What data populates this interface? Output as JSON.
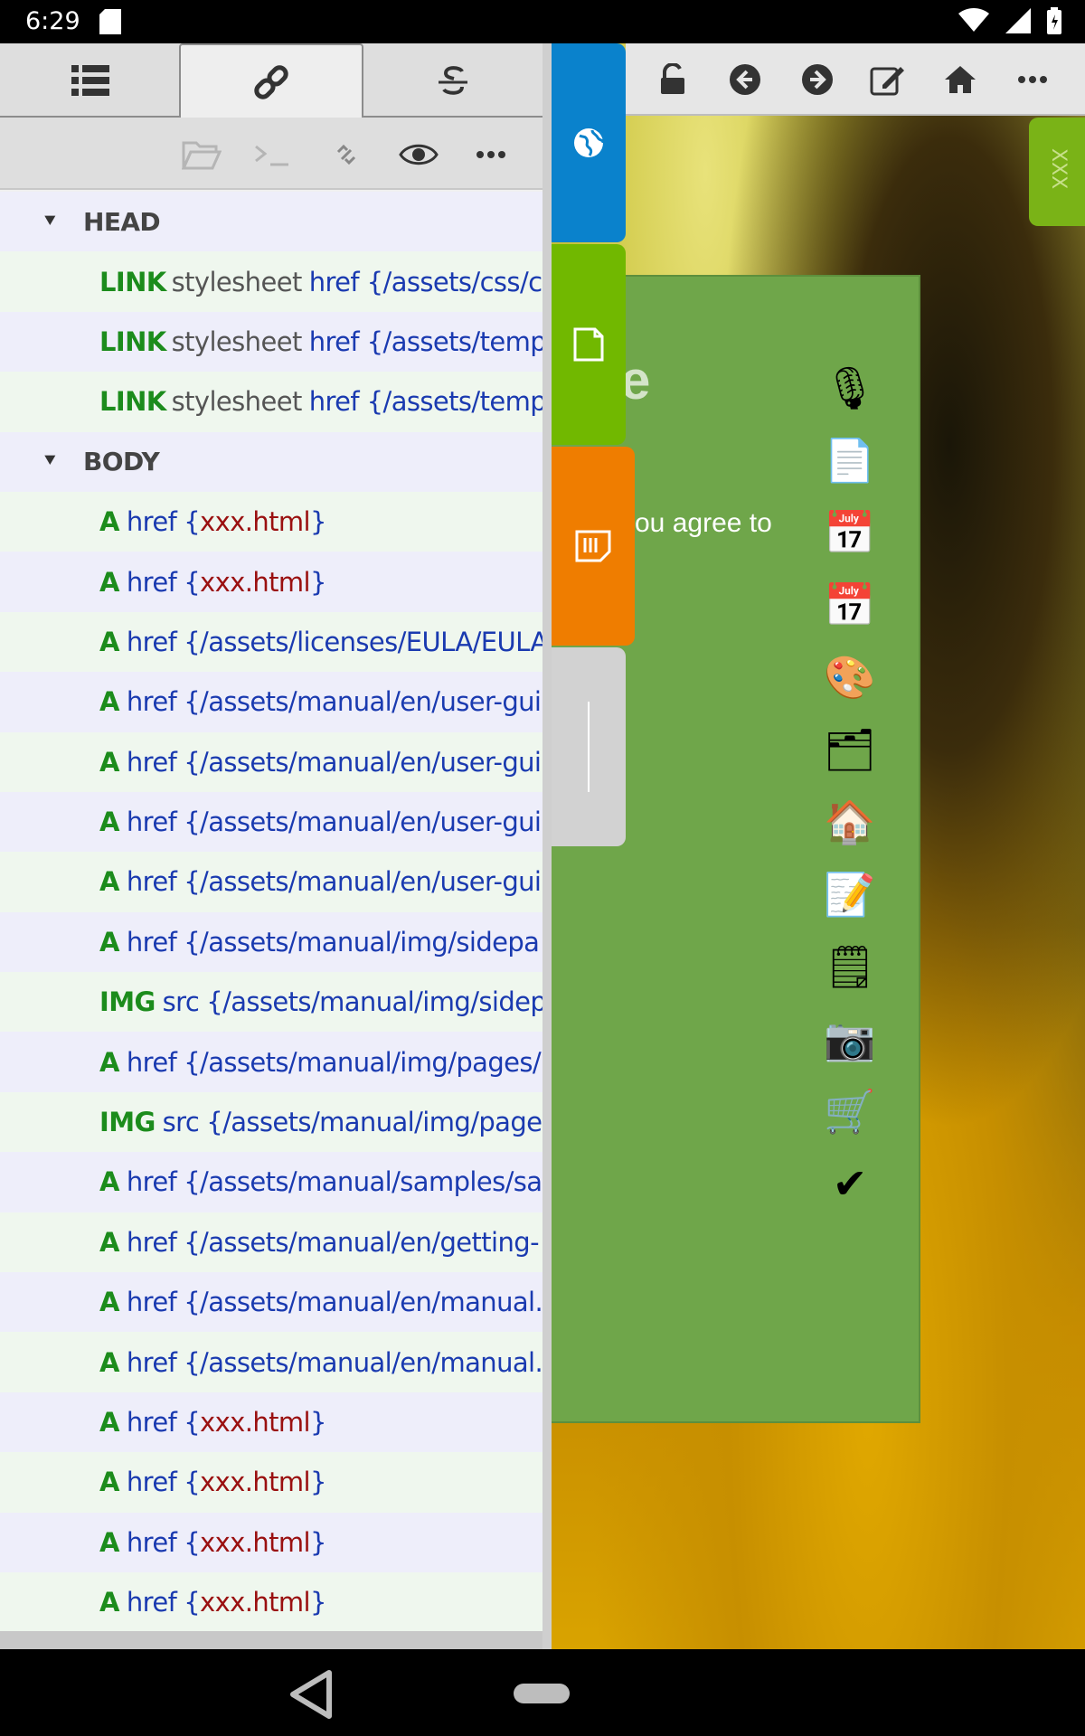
{
  "status_bar": {
    "time": "6:29"
  },
  "left_panel": {
    "tabs": [
      {
        "name": "list",
        "icon": "list-icon"
      },
      {
        "name": "links",
        "icon": "link-icon",
        "active": true
      },
      {
        "name": "strikethrough",
        "icon": "strikethrough-icon"
      }
    ],
    "subtoolbar": [
      {
        "icon": "folder-icon"
      },
      {
        "icon": "terminal-icon"
      },
      {
        "icon": "unlink-icon"
      },
      {
        "icon": "eye-icon"
      },
      {
        "icon": "more-icon"
      }
    ],
    "sections": {
      "head": "HEAD",
      "body": "BODY"
    },
    "head_rows": [
      {
        "tag": "LINK",
        "attr": "stylesheet",
        "key": "href",
        "value": "/assets/css/cl"
      },
      {
        "tag": "LINK",
        "attr": "stylesheet",
        "key": "href",
        "value": "/assets/templa"
      },
      {
        "tag": "LINK",
        "attr": "stylesheet",
        "key": "href",
        "value": "/assets/templa"
      }
    ],
    "body_rows": [
      {
        "tag": "A",
        "key": "href",
        "open": "{",
        "value": "xxx.html",
        "close": "}",
        "red": true
      },
      {
        "tag": "A",
        "key": "href",
        "open": "{",
        "value": "xxx.html",
        "close": "}",
        "red": true
      },
      {
        "tag": "A",
        "key": "href",
        "open": "{",
        "value": "/assets/licenses/EULA/EULA.",
        "close": "",
        "red": false
      },
      {
        "tag": "A",
        "key": "href",
        "open": "{",
        "value": "/assets/manual/en/user-gui",
        "close": "",
        "red": false
      },
      {
        "tag": "A",
        "key": "href",
        "open": "{",
        "value": "/assets/manual/en/user-gui",
        "close": "",
        "red": false
      },
      {
        "tag": "A",
        "key": "href",
        "open": "{",
        "value": "/assets/manual/en/user-gui",
        "close": "",
        "red": false
      },
      {
        "tag": "A",
        "key": "href",
        "open": "{",
        "value": "/assets/manual/en/user-gui",
        "close": "",
        "red": false
      },
      {
        "tag": "A",
        "key": "href",
        "open": "{",
        "value": "/assets/manual/img/sidepa",
        "close": "",
        "red": false
      },
      {
        "tag": "IMG",
        "key": "src",
        "open": "{",
        "value": "/assets/manual/img/sidep",
        "close": "",
        "red": false
      },
      {
        "tag": "A",
        "key": "href",
        "open": "{",
        "value": "/assets/manual/img/pages/",
        "close": "",
        "red": false
      },
      {
        "tag": "IMG",
        "key": "src",
        "open": "{",
        "value": "/assets/manual/img/pages",
        "close": "",
        "red": false
      },
      {
        "tag": "A",
        "key": "href",
        "open": "{",
        "value": "/assets/manual/samples/sa",
        "close": "",
        "red": false
      },
      {
        "tag": "A",
        "key": "href",
        "open": "{",
        "value": "/assets/manual/en/getting-",
        "close": "",
        "red": false
      },
      {
        "tag": "A",
        "key": "href",
        "open": "{",
        "value": "/assets/manual/en/manual.",
        "close": "",
        "red": false
      },
      {
        "tag": "A",
        "key": "href",
        "open": "{",
        "value": "/assets/manual/en/manual.",
        "close": "",
        "red": false
      },
      {
        "tag": "A",
        "key": "href",
        "open": "{",
        "value": "xxx.html",
        "close": "}",
        "red": true
      },
      {
        "tag": "A",
        "key": "href",
        "open": "{",
        "value": "xxx.html",
        "close": "}",
        "red": true
      },
      {
        "tag": "A",
        "key": "href",
        "open": "{",
        "value": "xxx.html",
        "close": "}",
        "red": true
      },
      {
        "tag": "A",
        "key": "href",
        "open": "{",
        "value": "xxx.html",
        "close": "}",
        "red": true
      }
    ]
  },
  "side_tabs": [
    {
      "color": "#0a82cc",
      "icon": "globe-icon"
    },
    {
      "color": "#71b800",
      "icon": "note-icon"
    },
    {
      "color": "#ef7d00",
      "icon": "bookmark-note-icon"
    },
    {
      "color": "#d2d2d2",
      "icon": "divider-icon"
    }
  ],
  "right_toolbar": [
    {
      "icon": "unlock-icon"
    },
    {
      "icon": "back-icon"
    },
    {
      "icon": "forward-icon"
    },
    {
      "icon": "edit-icon"
    },
    {
      "icon": "home-icon"
    },
    {
      "icon": "more-icon"
    }
  ],
  "right_tab": {
    "label": "XXX"
  },
  "page_card": {
    "fragment": "e",
    "agree_text": "ou agree to",
    "icons": [
      {
        "name": "microphone-icon",
        "glyph": "🎙"
      },
      {
        "name": "document-icon",
        "glyph": "📄"
      },
      {
        "name": "calendar-icon",
        "glyph": "📅"
      },
      {
        "name": "calendar-2-icon",
        "glyph": "📅"
      },
      {
        "name": "palette-icon",
        "glyph": "🎨"
      },
      {
        "name": "folder-icon",
        "glyph": "🗂"
      },
      {
        "name": "house-icon",
        "glyph": "🏠"
      },
      {
        "name": "pencil-note-icon",
        "glyph": "📝"
      },
      {
        "name": "notepad-icon",
        "glyph": "🗒"
      },
      {
        "name": "camera-icon",
        "glyph": "📷"
      },
      {
        "name": "cart-icon",
        "glyph": "🛒"
      },
      {
        "name": "checkmark-icon",
        "glyph": "✔"
      }
    ]
  },
  "colors": {
    "tag": "#1c8c1c",
    "link": "#1a3ab0",
    "red_value": "#9a1010"
  }
}
